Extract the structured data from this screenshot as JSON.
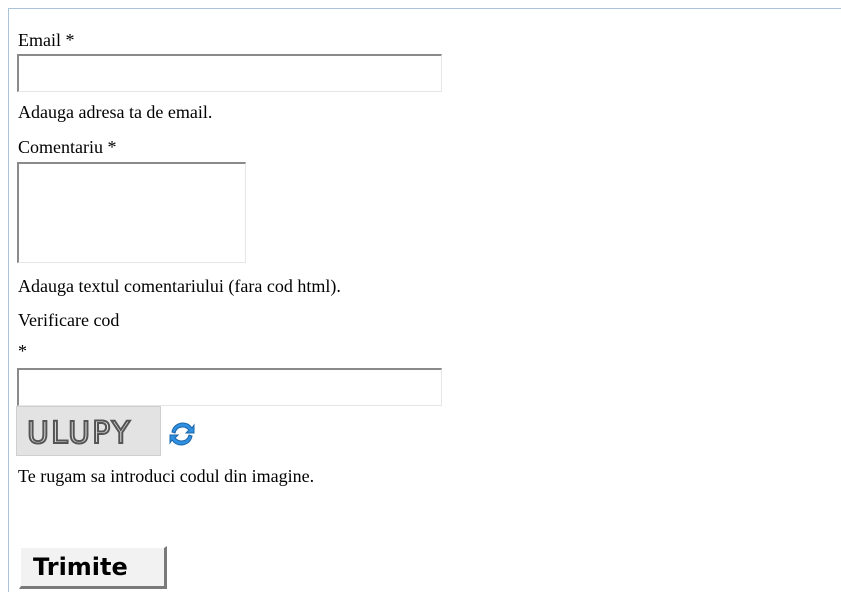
{
  "form": {
    "email": {
      "label": "Email *",
      "value": "",
      "hint": "Adauga adresa ta de email."
    },
    "comment": {
      "label": "Comentariu *",
      "value": "",
      "hint": "Adauga textul comentariului (fara cod html)."
    },
    "captcha": {
      "label": "Verificare cod",
      "required_mark": "*",
      "value": "",
      "image_text": "ULUPY",
      "refresh_icon": "refresh-icon",
      "hint": "Te rugam sa introduci codul din imagine."
    },
    "submit_label": "Trimite"
  },
  "colors": {
    "frame_border": "#a9c3dc",
    "field_border_dark": "#8a8a8a",
    "captcha_bg": "#e3e3e3",
    "refresh_blue": "#2f8fe0"
  }
}
